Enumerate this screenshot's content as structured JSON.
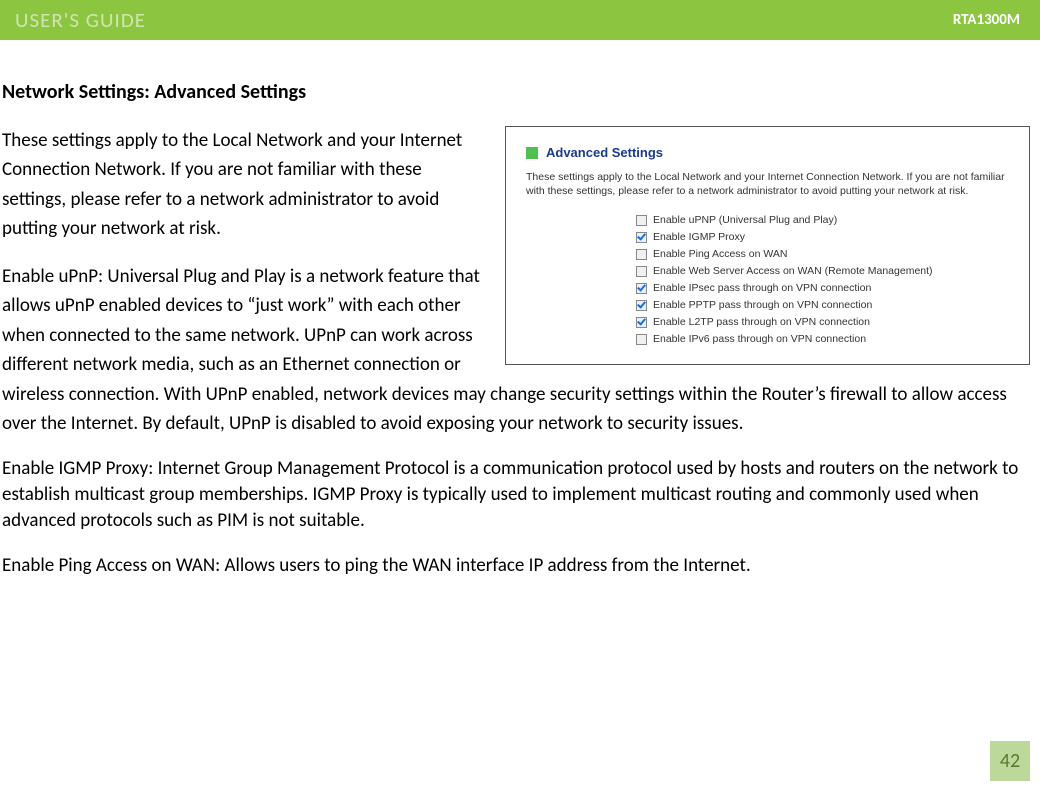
{
  "header": {
    "left": "USER'S GUIDE",
    "right": "RTA1300M"
  },
  "title": "Network Settings: Advanced Settings",
  "paragraphs": {
    "intro": "These settings apply to the Local Network and your Internet Connection Network.  If you are not familiar with these settings, please refer to a network administrator to avoid putting your network at risk.",
    "upnp": "Enable uPnP: Universal Plug and Play is a network feature that allows uPnP enabled devices to “just work” with each other when connected to the same network.  UPnP can work across different network media, such as an Ethernet connection or wireless connection.  With UPnP enabled, network devices may change security settings within the Router’s firewall to allow access over the Internet.  By default, UPnP is disabled to avoid exposing your network to security issues.",
    "igmp": "Enable IGMP Proxy: Internet Group Management Protocol is a communication protocol used by hosts and routers on the network to establish multicast group memberships.  IGMP Proxy is typically used to implement multicast routing and commonly used when advanced protocols such as PIM is not suitable.",
    "ping": "Enable Ping Access on WAN: Allows users to ping the WAN interface IP address from the Internet."
  },
  "screenshot": {
    "title": "Advanced Settings",
    "desc": "These settings apply to the Local Network and your Internet Connection Network.  If you are not familiar with these settings, please refer to a network administrator to avoid putting your network at risk.",
    "options": [
      {
        "label": "Enable uPNP (Universal Plug and Play)",
        "checked": false
      },
      {
        "label": "Enable IGMP Proxy",
        "checked": true
      },
      {
        "label": "Enable Ping Access on WAN",
        "checked": false
      },
      {
        "label": "Enable Web Server Access on WAN (Remote Management)",
        "checked": false
      },
      {
        "label": "Enable IPsec pass through on VPN connection",
        "checked": true
      },
      {
        "label": "Enable PPTP pass through on VPN connection",
        "checked": true
      },
      {
        "label": "Enable L2TP pass through on VPN connection",
        "checked": true
      },
      {
        "label": "Enable IPv6 pass through on VPN connection",
        "checked": false
      }
    ]
  },
  "page_number": "42"
}
